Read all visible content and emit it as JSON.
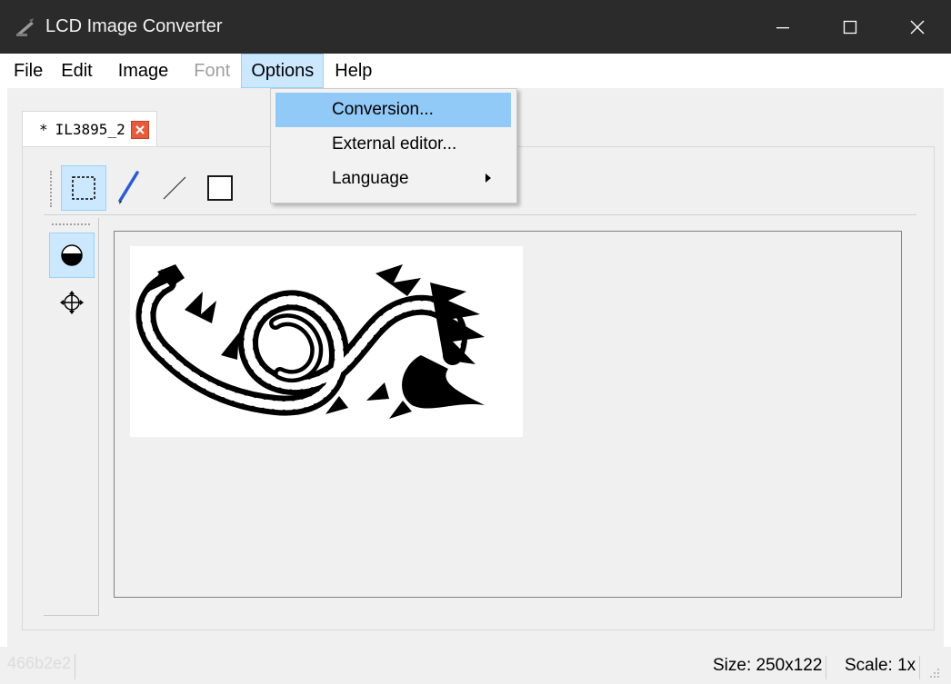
{
  "window": {
    "title": "LCD Image Converter"
  },
  "menubar": {
    "items": [
      {
        "label": "File",
        "disabled": false
      },
      {
        "label": "Edit",
        "disabled": false
      },
      {
        "label": "Image",
        "disabled": false
      },
      {
        "label": "Font",
        "disabled": true
      },
      {
        "label": "Options",
        "disabled": false,
        "active": true
      },
      {
        "label": "Help",
        "disabled": false
      }
    ]
  },
  "options_menu": {
    "items": [
      {
        "label": "Conversion...",
        "highlighted": true,
        "has_submenu": false
      },
      {
        "label": "External editor...",
        "highlighted": false,
        "has_submenu": false
      },
      {
        "label": "Language",
        "highlighted": false,
        "has_submenu": true
      }
    ]
  },
  "tab": {
    "modified_marker": "*",
    "label": "IL3895_2"
  },
  "toolbar": {
    "tools": [
      "select-rect-icon",
      "pen-icon",
      "line-icon",
      "rectangle-icon"
    ]
  },
  "side_tools": [
    "fill-circle-icon",
    "move-icon"
  ],
  "statusbar": {
    "left_text": "466b2e2",
    "size_label": "Size: 250x122",
    "scale_label": "Scale: 1x"
  },
  "colors": {
    "titlebar_bg": "#2b2b2b",
    "menu_highlight": "#91c9f7",
    "tool_selected": "#cce8ff",
    "close_tab": "#e85a3c"
  }
}
